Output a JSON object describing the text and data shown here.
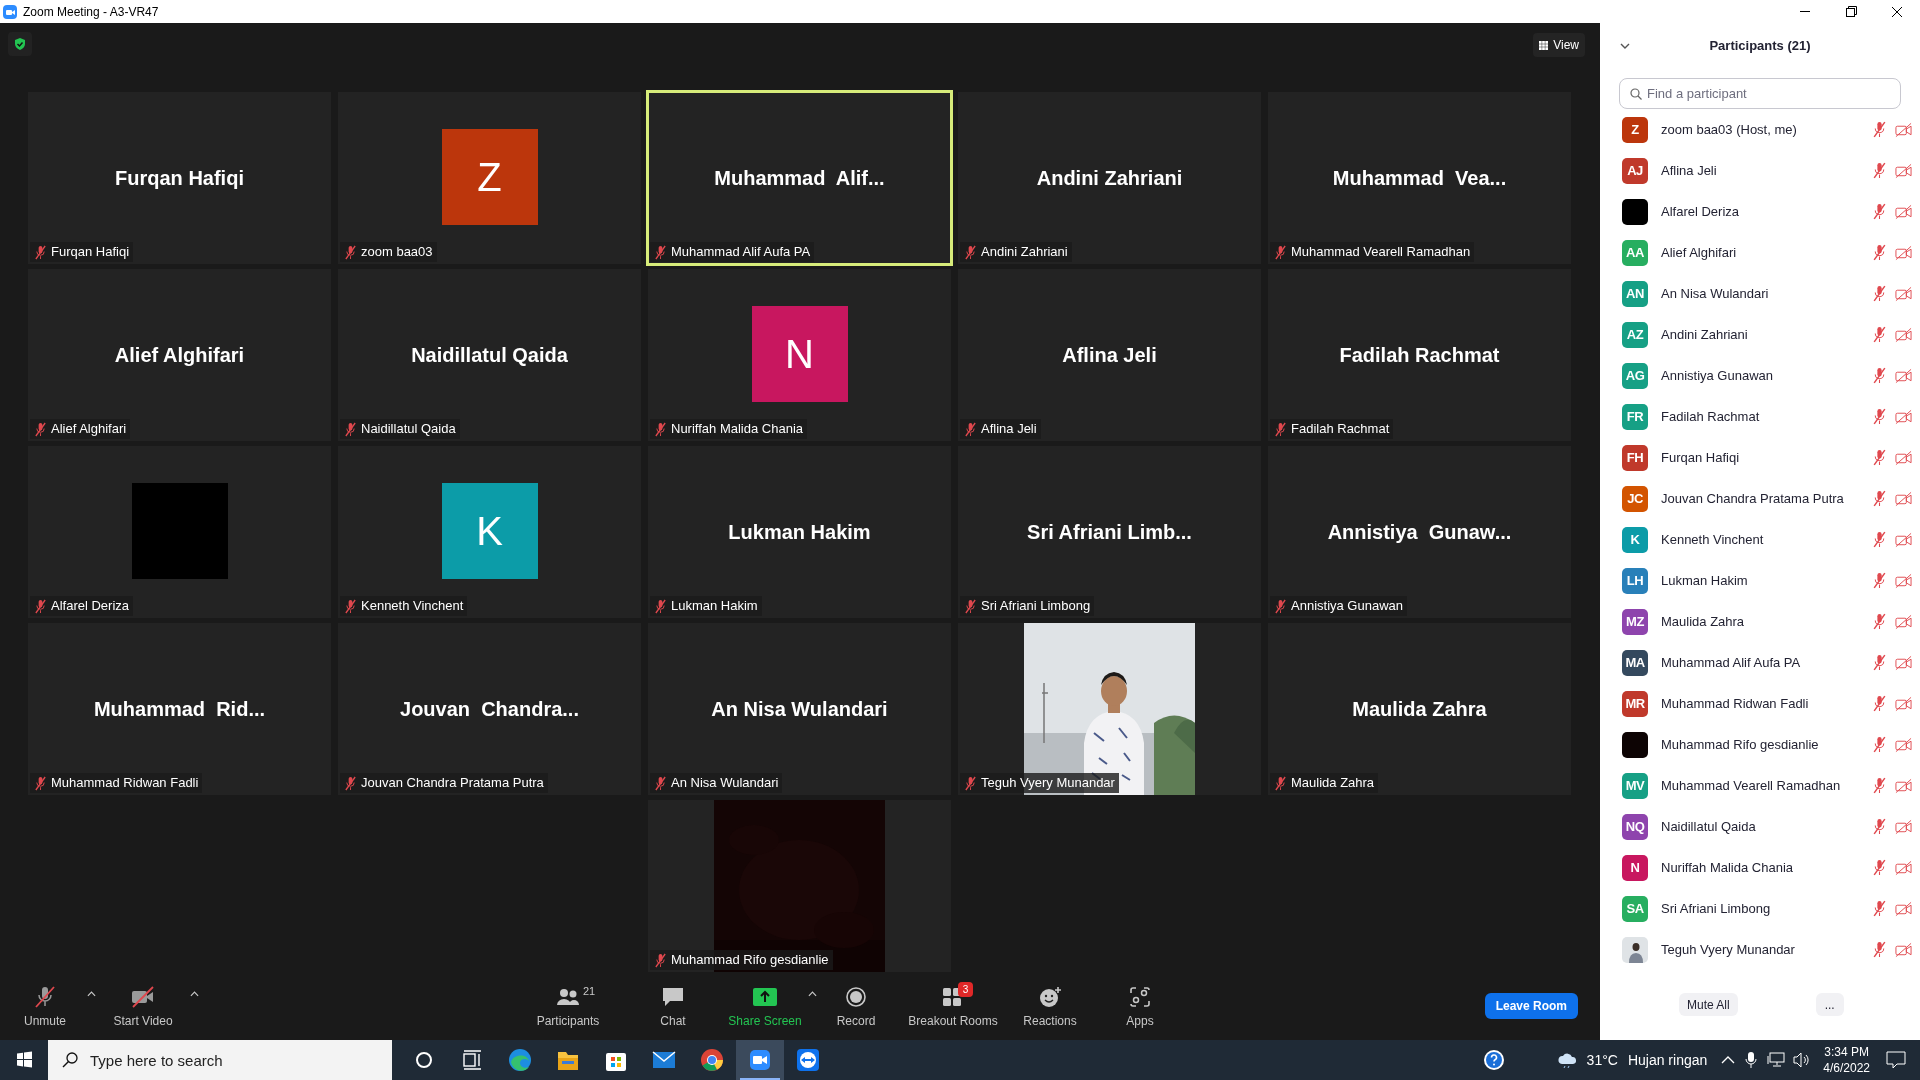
{
  "window": {
    "title": "Zoom Meeting - A3-VR47"
  },
  "view_button": "View",
  "tiles": [
    {
      "kind": "name",
      "display": "Furqan Hafiqi",
      "label": "Furqan Hafiqi",
      "muted": true,
      "speaking": false
    },
    {
      "kind": "avatar",
      "display": "Z",
      "color": "#bc360c",
      "label": "zoom baa03",
      "muted": true,
      "speaking": false
    },
    {
      "kind": "name",
      "display": "Muhammad  Alif...",
      "label": "Muhammad Alif Aufa PA",
      "muted": true,
      "speaking": true
    },
    {
      "kind": "name",
      "display": "Andini Zahriani",
      "label": "Andini Zahriani",
      "muted": true,
      "speaking": false
    },
    {
      "kind": "name",
      "display": "Muhammad  Vea...",
      "label": "Muhammad Vearell Ramadhan",
      "muted": true,
      "speaking": false
    },
    {
      "kind": "name",
      "display": "Alief Alghifari",
      "label": "Alief Alghifari",
      "muted": true,
      "speaking": false
    },
    {
      "kind": "name",
      "display": "Naidillatul Qaida",
      "label": "Naidillatul Qaida",
      "muted": true,
      "speaking": false
    },
    {
      "kind": "avatar",
      "display": "N",
      "color": "#c8175f",
      "label": "Nuriffah Malida Chania",
      "muted": true,
      "speaking": false
    },
    {
      "kind": "name",
      "display": "Aflina Jeli",
      "label": "Aflina Jeli",
      "muted": true,
      "speaking": false
    },
    {
      "kind": "name",
      "display": "Fadilah Rachmat",
      "label": "Fadilah Rachmat",
      "muted": true,
      "speaking": false
    },
    {
      "kind": "avatar",
      "color": "#000000",
      "label": "Alfarel Deriza",
      "muted": true,
      "speaking": false
    },
    {
      "kind": "avatar",
      "display": "K",
      "color": "#0c9ca8",
      "label": "Kenneth Vinchent",
      "muted": true,
      "speaking": false
    },
    {
      "kind": "name",
      "display": "Lukman Hakim",
      "label": "Lukman Hakim",
      "muted": true,
      "speaking": false
    },
    {
      "kind": "name",
      "display": "Sri Afriani Limb...",
      "label": "Sri Afriani Limbong",
      "muted": true,
      "speaking": false
    },
    {
      "kind": "name",
      "display": "Annistiya  Gunaw...",
      "label": "Annistiya Gunawan",
      "muted": true,
      "speaking": false
    },
    {
      "kind": "name",
      "display": "Muhammad  Rid...",
      "label": "Muhammad Ridwan Fadli",
      "muted": true,
      "speaking": false
    },
    {
      "kind": "name",
      "display": "Jouvan  Chandra...",
      "label": "Jouvan Chandra Pratama Putra",
      "muted": true,
      "speaking": false
    },
    {
      "kind": "name",
      "display": "An Nisa Wulandari",
      "label": "An Nisa Wulandari",
      "muted": true,
      "speaking": false
    },
    {
      "label": "Teguh Vyery Munandar",
      "muted": true,
      "speaking": false
    },
    {
      "kind": "name",
      "display": "Maulida Zahra",
      "label": "Maulida Zahra",
      "muted": true,
      "speaking": false
    },
    {
      "kind": "dark",
      "label": "Muhammad Rifo gesdianlie",
      "muted": true,
      "speaking": false
    }
  ],
  "toolbar": [
    {
      "kind": "mic",
      "label": "Unmute",
      "caret": true
    },
    {
      "kind": "video",
      "label": "Start Video",
      "caret": true
    },
    {
      "kind": "participants",
      "label": "Participants",
      "count": "21"
    },
    {
      "kind": "chat",
      "label": "Chat"
    },
    {
      "kind": "share",
      "label": "Share Screen",
      "caret": true
    },
    {
      "kind": "record",
      "label": "Record"
    },
    {
      "kind": "breakout",
      "label": "Breakout Rooms",
      "badge": "3"
    },
    {
      "kind": "reactions",
      "label": "Reactions"
    },
    {
      "kind": "apps",
      "label": "Apps"
    }
  ],
  "leave_button": "Leave Room",
  "panel": {
    "title": "Participants (21)",
    "search": {
      "placeholder": "Find a participant"
    },
    "participants": [
      {
        "name": "zoom baa03 (Host, me)",
        "initials": "Z",
        "color": "#bc360c",
        "muted": true,
        "video_on": false
      },
      {
        "name": "Aflina Jeli",
        "initials": "AJ",
        "color": "#c0392b",
        "muted": true,
        "video_on": false
      },
      {
        "name": "Alfarel Deriza",
        "color": "#000000",
        "muted": true,
        "video_on": false
      },
      {
        "name": "Alief Alghifari",
        "initials": "AA",
        "color": "#27ae60",
        "muted": true,
        "video_on": false
      },
      {
        "name": "An Nisa Wulandari",
        "initials": "AN",
        "color": "#16a085",
        "muted": true,
        "video_on": false
      },
      {
        "name": "Andini Zahriani",
        "initials": "AZ",
        "color": "#16a085",
        "muted": true,
        "video_on": false
      },
      {
        "name": "Annistiya Gunawan",
        "initials": "AG",
        "color": "#16a085",
        "muted": true,
        "video_on": false
      },
      {
        "name": "Fadilah Rachmat",
        "initials": "FR",
        "color": "#16a085",
        "muted": true,
        "video_on": false
      },
      {
        "name": "Furqan Hafiqi",
        "initials": "FH",
        "color": "#c0392b",
        "muted": true,
        "video_on": false
      },
      {
        "name": "Jouvan Chandra Pratama Putra",
        "initials": "JC",
        "color": "#d35400",
        "muted": true,
        "video_on": false
      },
      {
        "name": "Kenneth Vinchent",
        "initials": "K",
        "color": "#0c9ca8",
        "muted": true,
        "video_on": false
      },
      {
        "name": "Lukman Hakim",
        "initials": "LH",
        "color": "#2980b9",
        "muted": true,
        "video_on": false
      },
      {
        "name": "Maulida Zahra",
        "initials": "MZ",
        "color": "#8e44ad",
        "muted": true,
        "video_on": false
      },
      {
        "name": "Muhammad Alif Aufa PA",
        "initials": "MA",
        "color": "#34495e",
        "muted": true,
        "video_on": false
      },
      {
        "name": "Muhammad Ridwan Fadli",
        "initials": "MR",
        "color": "#c0392b",
        "muted": true,
        "video_on": false
      },
      {
        "name": "Muhammad Rifo gesdianlie",
        "color": "#0d0404",
        "muted": true,
        "video_on": false
      },
      {
        "name": "Muhammad Vearell Ramadhan",
        "initials": "MV",
        "color": "#16a085",
        "muted": true,
        "video_on": false
      },
      {
        "name": "Naidillatul Qaida",
        "initials": "NQ",
        "color": "#8e44ad",
        "muted": true,
        "video_on": false
      },
      {
        "name": "Nuriffah Malida Chania",
        "initials": "N",
        "color": "#c8175f",
        "muted": true,
        "video_on": false
      },
      {
        "name": "Sri Afriani Limbong",
        "initials": "SA",
        "color": "#27ae60",
        "muted": true,
        "video_on": false
      },
      {
        "name": "Teguh Vyery Munandar",
        "muted": true,
        "video_on": false
      }
    ],
    "buttons": [
      "Mute All",
      "..."
    ]
  },
  "taskbar": {
    "search": {
      "placeholder": "Type here to search"
    },
    "weather": "31°C",
    "weather_text": "Hujan ringan",
    "time": "3:34 PM",
    "date": "4/6/2022"
  }
}
